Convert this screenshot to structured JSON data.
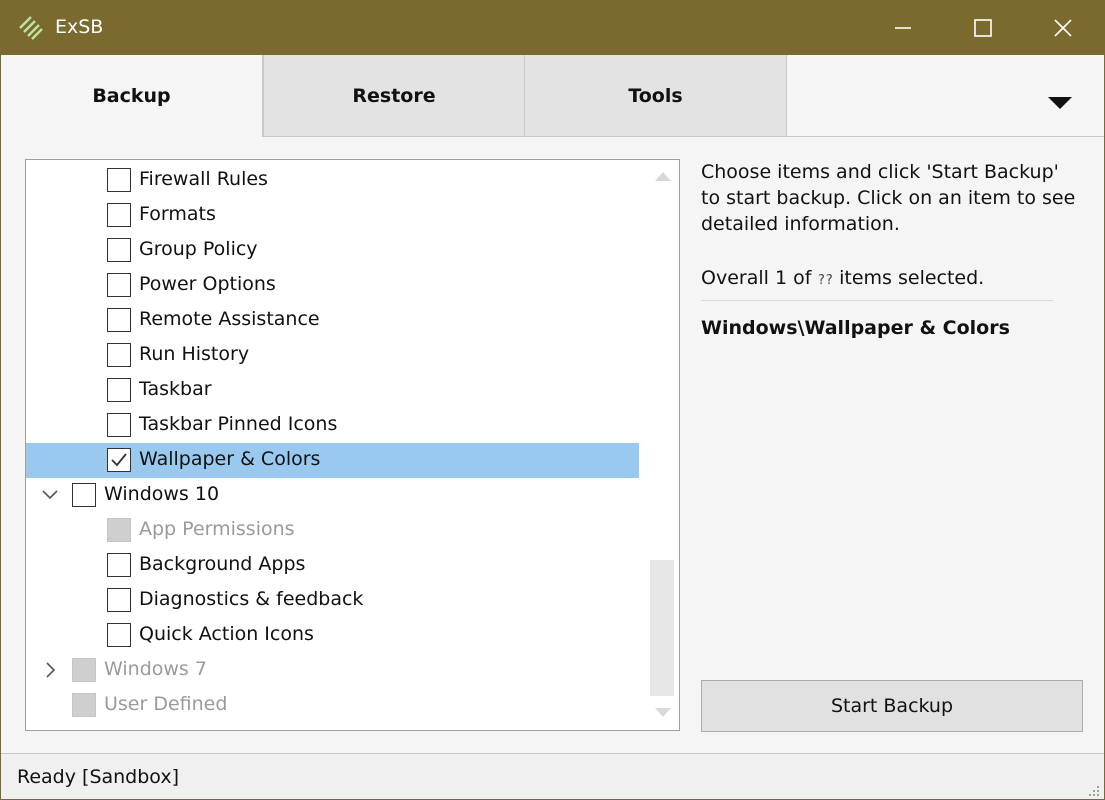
{
  "window": {
    "title": "ExSB",
    "accent_color": "#7a6a2e",
    "controls": [
      "minimize-icon",
      "maximize-icon",
      "close-icon"
    ]
  },
  "tabs": [
    {
      "label": "Backup",
      "active": true
    },
    {
      "label": "Restore",
      "active": false
    },
    {
      "label": "Tools",
      "active": false
    }
  ],
  "tree": {
    "items": [
      {
        "label": "Firewall Rules",
        "level": 2,
        "checked": false,
        "disabled": false,
        "selected": false
      },
      {
        "label": "Formats",
        "level": 2,
        "checked": false,
        "disabled": false,
        "selected": false
      },
      {
        "label": "Group Policy",
        "level": 2,
        "checked": false,
        "disabled": false,
        "selected": false
      },
      {
        "label": "Power Options",
        "level": 2,
        "checked": false,
        "disabled": false,
        "selected": false
      },
      {
        "label": "Remote Assistance",
        "level": 2,
        "checked": false,
        "disabled": false,
        "selected": false
      },
      {
        "label": "Run History",
        "level": 2,
        "checked": false,
        "disabled": false,
        "selected": false
      },
      {
        "label": "Taskbar",
        "level": 2,
        "checked": false,
        "disabled": false,
        "selected": false
      },
      {
        "label": "Taskbar Pinned Icons",
        "level": 2,
        "checked": false,
        "disabled": false,
        "selected": false
      },
      {
        "label": "Wallpaper & Colors",
        "level": 2,
        "checked": true,
        "disabled": false,
        "selected": true
      },
      {
        "label": "Windows 10",
        "level": 1,
        "checked": false,
        "disabled": false,
        "selected": false,
        "expander": "expanded"
      },
      {
        "label": "App Permissions",
        "level": 2,
        "checked": false,
        "disabled": true,
        "selected": false
      },
      {
        "label": "Background Apps",
        "level": 2,
        "checked": false,
        "disabled": false,
        "selected": false
      },
      {
        "label": "Diagnostics & feedback",
        "level": 2,
        "checked": false,
        "disabled": false,
        "selected": false
      },
      {
        "label": "Quick Action Icons",
        "level": 2,
        "checked": false,
        "disabled": false,
        "selected": false
      },
      {
        "label": "Windows 7",
        "level": 1,
        "checked": false,
        "disabled": true,
        "selected": false,
        "expander": "collapsed"
      },
      {
        "label": "User Defined",
        "level": 1,
        "checked": false,
        "disabled": true,
        "selected": false,
        "expander": "none"
      }
    ]
  },
  "info": {
    "description": "Choose items and click 'Start Backup' to start backup. Click on an item to see detailed information.",
    "count_prefix": "Overall 1 of ",
    "count_total": "??",
    "count_suffix": " items selected.",
    "selected_path": "Windows\\Wallpaper & Colors"
  },
  "actions": {
    "start_backup": "Start Backup"
  },
  "status": {
    "text": "Ready [Sandbox]"
  }
}
